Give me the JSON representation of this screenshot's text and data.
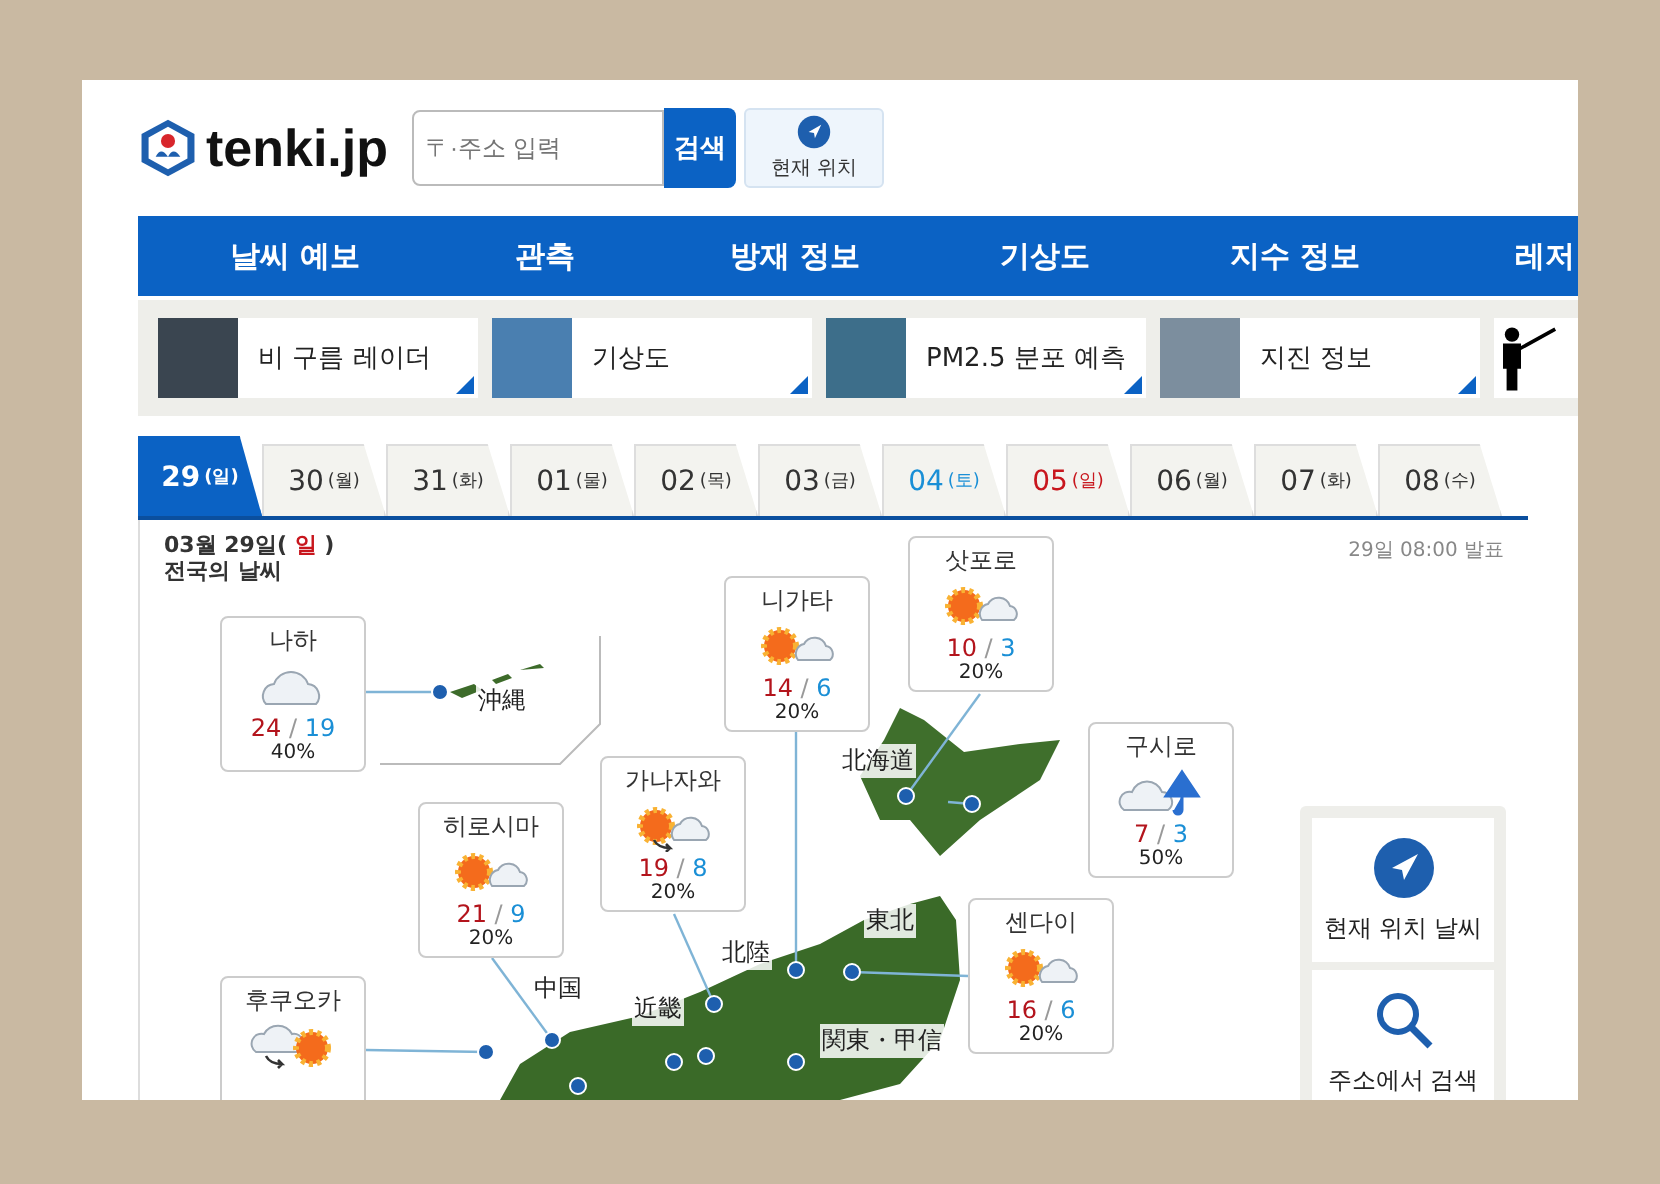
{
  "header": {
    "logo": "tenki.jp",
    "search": {
      "placeholder": "〒·주소 입력",
      "button": "검색"
    },
    "location_button": "현재 위치"
  },
  "nav": [
    "날씨 예보",
    "관측",
    "방재 정보",
    "기상도",
    "지수 정보",
    "레저"
  ],
  "tiles": [
    {
      "label": "비 구름 레이더",
      "kind": "radar"
    },
    {
      "label": "기상도",
      "kind": "satellite"
    },
    {
      "label": "PM2.5 분포 예측",
      "kind": "pm25"
    },
    {
      "label": "지진 정보",
      "kind": "quake"
    },
    {
      "kind": "leisure"
    }
  ],
  "tabs": [
    {
      "date": "29",
      "day": "(일)",
      "selected": true
    },
    {
      "date": "30",
      "day": "(월)",
      "color": "#333333",
      "selected": false
    },
    {
      "date": "31",
      "day": "(화)",
      "color": "#333333",
      "selected": false
    },
    {
      "date": "01",
      "day": "(물)",
      "color": "#333333",
      "selected": false
    },
    {
      "date": "02",
      "day": "(목)",
      "color": "#333333",
      "selected": false
    },
    {
      "date": "03",
      "day": "(금)",
      "color": "#333333",
      "selected": false
    },
    {
      "date": "04",
      "day": "(토)",
      "color": "#1a8fd6",
      "selected": false
    },
    {
      "date": "05",
      "day": "(일)",
      "color": "#c8161d",
      "selected": false
    },
    {
      "date": "06",
      "day": "(월)",
      "color": "#333333",
      "selected": false
    },
    {
      "date": "07",
      "day": "(화)",
      "color": "#333333",
      "selected": false
    },
    {
      "date": "08",
      "day": "(수)",
      "color": "#333333",
      "selected": false
    }
  ],
  "forecast": {
    "date_prefix": "03월 29일(",
    "weekday": "일",
    "date_suffix": ")",
    "subtitle": "전국의 날씨",
    "issued": "29일 08:00 발표",
    "cities": [
      {
        "name": "나하",
        "kind": "cloud",
        "high": "24",
        "sep": "/",
        "low": "19",
        "pop": "40%"
      },
      {
        "name": "니가타",
        "kind": "sun-cloud",
        "high": "14",
        "sep": "/",
        "low": "6",
        "pop": "20%"
      },
      {
        "name": "삿포로",
        "kind": "sun-cloud",
        "high": "10",
        "sep": "/",
        "low": "3",
        "pop": "20%"
      },
      {
        "name": "구시로",
        "kind": "cloud-umbrella",
        "high": "7",
        "sep": "/",
        "low": "3",
        "pop": "50%"
      },
      {
        "name": "가나자와",
        "kind": "sun-then-cloud",
        "high": "19",
        "sep": "/",
        "low": "8",
        "pop": "20%"
      },
      {
        "name": "히로시마",
        "kind": "sun-cloud",
        "high": "21",
        "sep": "/",
        "low": "9",
        "pop": "20%"
      },
      {
        "name": "센다이",
        "kind": "sun-cloud",
        "high": "16",
        "sep": "/",
        "low": "6",
        "pop": "20%"
      },
      {
        "name": "후쿠오카",
        "kind": "cloud-then-sun"
      }
    ],
    "regions": [
      "沖縄",
      "北海道",
      "東北",
      "北陸",
      "中国",
      "近畿",
      "関東・甲信"
    ],
    "side_buttons": [
      {
        "label": "현재 위치 날씨",
        "kind": "location"
      },
      {
        "label": "주소에서 검색",
        "kind": "search"
      }
    ]
  }
}
